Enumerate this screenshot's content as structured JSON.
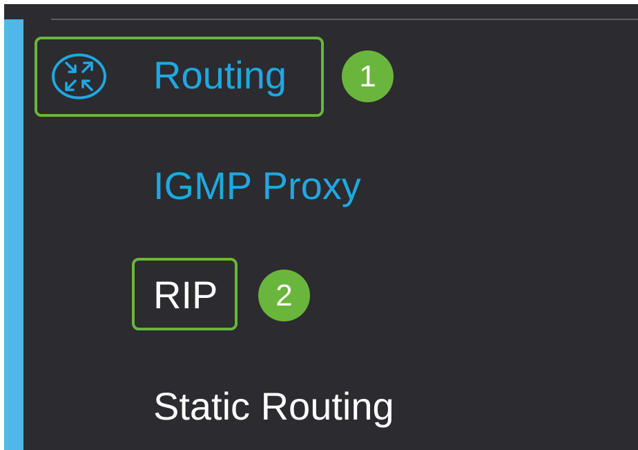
{
  "colors": {
    "panel_background": "#2b2b30",
    "accent": "#4fb7ea",
    "link_blue": "#1fa8e0",
    "text_white": "#ffffff",
    "highlight_green": "#6ab63c"
  },
  "nav": {
    "routing": {
      "label": "Routing",
      "icon": "routing-arrows-icon"
    },
    "igmp_proxy": {
      "label": "IGMP Proxy"
    },
    "rip": {
      "label": "RIP"
    },
    "static_routing": {
      "label": "Static Routing"
    }
  },
  "callouts": {
    "step1": "1",
    "step2": "2"
  }
}
